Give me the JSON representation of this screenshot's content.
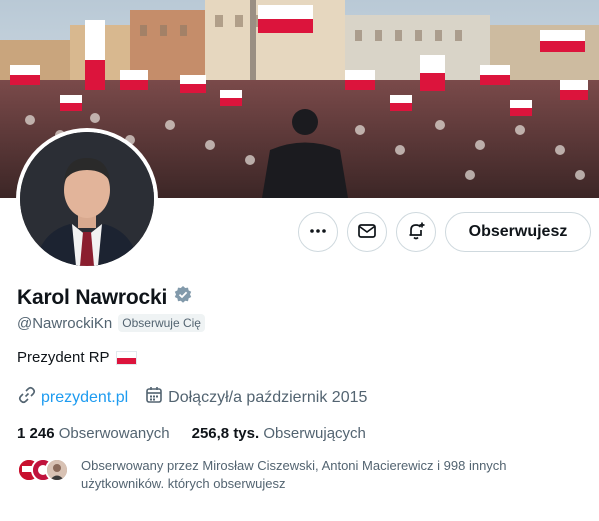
{
  "profile": {
    "name": "Karol Nawrocki",
    "handle": "@NawrockiKn",
    "follows_you_badge": "Obserwuje Cię",
    "bio": "Prezydent RP",
    "bio_flag": "poland-flag-icon",
    "verified_color": "#829aab",
    "website": "prezydent.pl",
    "joined": "Dołączył/a październik 2015",
    "following_count": "1 246",
    "following_label": "Obserwowanych",
    "followers_count": "256,8 tys.",
    "followers_label": "Obserwujących",
    "followed_by_text": "Obserwowany przez Mirosław Ciszewski, Antoni Macierewicz i 998 innych użytkowników. których obserwujesz"
  },
  "actions": {
    "more_icon": "more-icon",
    "message_icon": "mail-icon",
    "notify_icon": "bell-plus-icon",
    "follow_label": "Obserwujesz"
  },
  "colors": {
    "link": "#1d9bf0",
    "secondary_text": "#536471",
    "primary_text": "#0f1419",
    "border": "#cfd9de",
    "flag_red": "#dc143c"
  }
}
